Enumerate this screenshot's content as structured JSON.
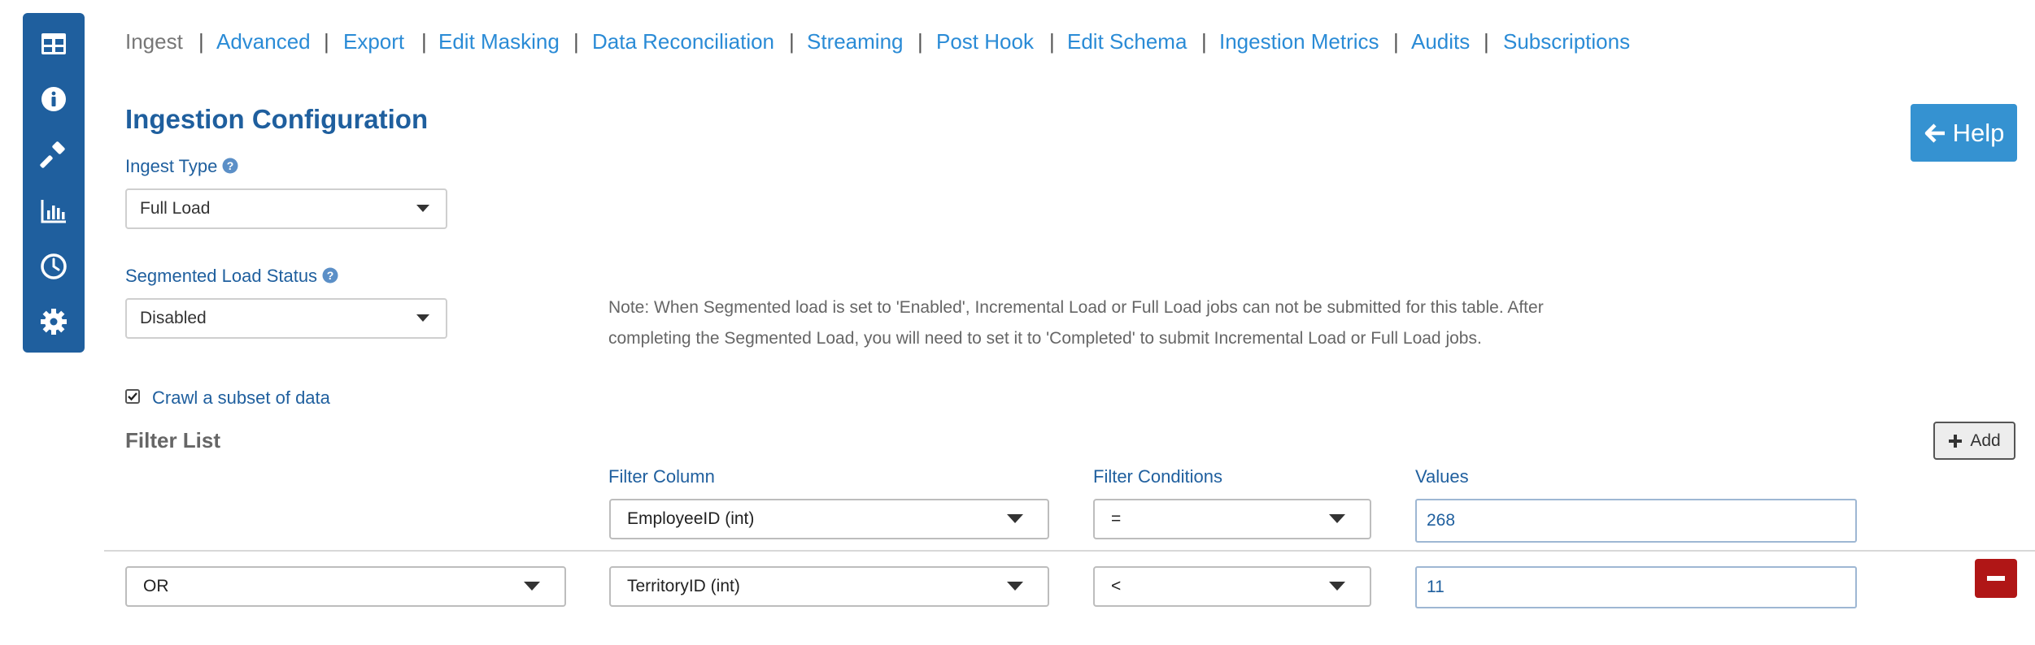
{
  "sidebar": {
    "icons": [
      "table-icon",
      "info-icon",
      "gavel-icon",
      "bar-chart-icon",
      "clock-icon",
      "gear-icon"
    ]
  },
  "tabs": [
    {
      "label": "Ingest",
      "active": true
    },
    {
      "label": "Advanced"
    },
    {
      "label": "Export"
    },
    {
      "label": "Edit Masking"
    },
    {
      "label": "Data Reconciliation"
    },
    {
      "label": "Streaming"
    },
    {
      "label": "Post Hook"
    },
    {
      "label": "Edit Schema"
    },
    {
      "label": "Ingestion Metrics"
    },
    {
      "label": "Audits"
    },
    {
      "label": "Subscriptions"
    }
  ],
  "tab_separator": "|",
  "page_title": "Ingestion Configuration",
  "help_button": {
    "label": "Help",
    "icon": "arrow-left-icon"
  },
  "ingest_type": {
    "label": "Ingest Type",
    "value": "Full Load"
  },
  "segmented_load": {
    "label": "Segmented Load Status",
    "value": "Disabled"
  },
  "note": "Note: When Segmented load is set to 'Enabled', Incremental Load or Full Load jobs can not be submitted for this table. After completing the Segmented Load, you will need to set it to 'Completed' to submit Incremental Load or Full Load jobs.",
  "crawl_subset": {
    "label": "Crawl a subset of data",
    "checked": true
  },
  "filter_list": {
    "title": "Filter List",
    "add_label": "Add",
    "headers": {
      "column": "Filter Column",
      "condition": "Filter Conditions",
      "values": "Values"
    },
    "rows": [
      {
        "column": "EmployeeID (int)",
        "condition": "=",
        "value": "268"
      },
      {
        "logic": "OR",
        "column": "TerritoryID (int)",
        "condition": "<",
        "value": "11"
      }
    ]
  },
  "colors": {
    "sidebar": "#1f5f9e",
    "link": "#2a8bd6",
    "heading": "#1f5f9e",
    "help_button": "#3592d1",
    "remove_button": "#b01616"
  }
}
